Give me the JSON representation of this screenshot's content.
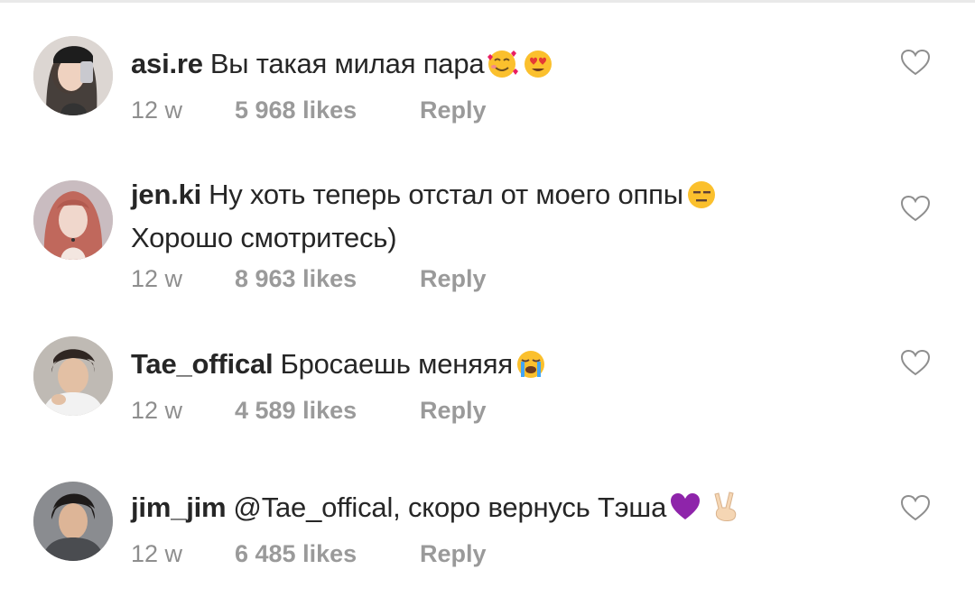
{
  "comments": [
    {
      "username": "asi.re",
      "text": "Вы такая милая пара",
      "emojis": [
        "smiling-face-with-hearts",
        "heart-eyes"
      ],
      "time": "12 w",
      "likes": "5 968 likes",
      "reply": "Reply"
    },
    {
      "username": "jen.ki",
      "text": "Ну хоть теперь отстал от моего оппы",
      "emojis": [
        "expressionless-face"
      ],
      "text2": "Хорошо смотритесь)",
      "time": "12 w",
      "likes": "8 963 likes",
      "reply": "Reply"
    },
    {
      "username": "Tae_offical",
      "text": "Бросаешь меняяя",
      "emojis": [
        "loudly-crying-face"
      ],
      "time": "12 w",
      "likes": "4 589 likes",
      "reply": "Reply"
    },
    {
      "username": "jim_jim",
      "text": "@Tae_offical, скоро вернусь Тэша",
      "emojis": [
        "purple-heart",
        "victory-hand"
      ],
      "time": "12 w",
      "likes": "6 485 likes",
      "reply": "Reply"
    }
  ],
  "icons": {
    "like": "heart-outline-icon"
  },
  "colors": {
    "text": "#262626",
    "meta": "#8e8e8e",
    "heart_outline": "#8e8e8e"
  }
}
